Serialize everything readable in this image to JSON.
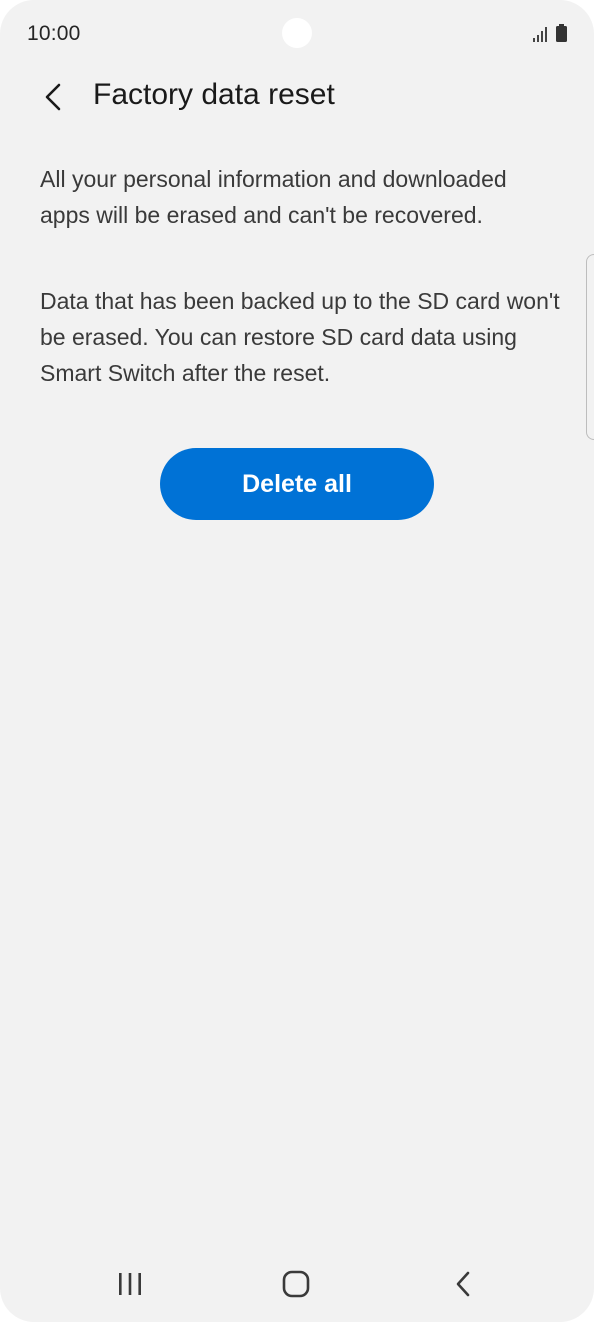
{
  "status_bar": {
    "time": "10:00",
    "icons": [
      "signal-icon",
      "battery-icon"
    ]
  },
  "header": {
    "back_icon": "chevron-left-icon",
    "title": "Factory data reset"
  },
  "content": {
    "paragraph_1": "All your personal information and downloaded apps will be erased and can't be recovered.",
    "paragraph_2": "Data that has been backed up to the SD card won't be erased. You can restore SD card data using Smart Switch after the reset.",
    "delete_button_label": "Delete all"
  },
  "nav_bar": {
    "icons": [
      "recent-apps-icon",
      "home-icon",
      "back-icon"
    ]
  },
  "colors": {
    "background": "#f2f2f2",
    "accent": "#0072d6",
    "button_text": "#ffffff",
    "title_text": "#1a1a1a",
    "body_text": "#3a3a3a"
  }
}
